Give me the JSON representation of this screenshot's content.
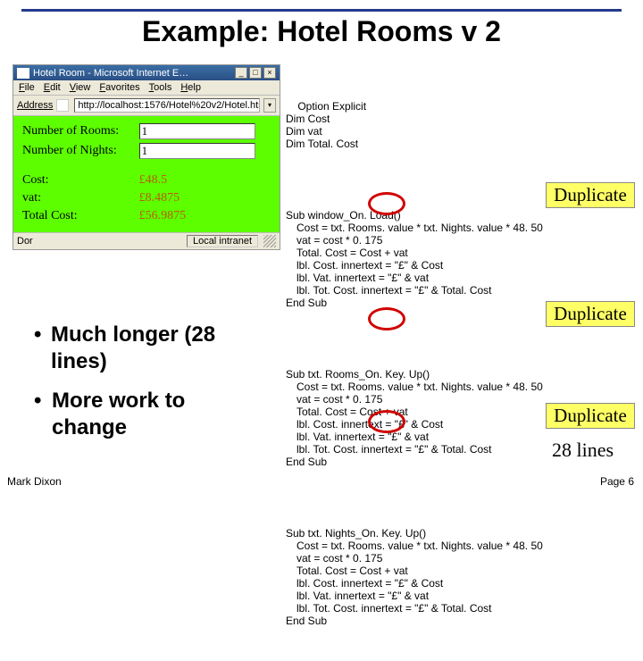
{
  "title": "Example: Hotel Rooms v 2",
  "browser": {
    "window_title": "Hotel Room - Microsoft Internet E…",
    "menu": [
      "File",
      "Edit",
      "View",
      "Favorites",
      "Tools",
      "Help"
    ],
    "address_label": "Address",
    "url": "http://localhost:1576/Hotel%20v2/Hotel.htm",
    "form": {
      "rooms_label": "Number of Rooms:",
      "rooms_value": "1",
      "nights_label": "Number of Nights:",
      "nights_value": "1",
      "cost_label": "Cost:",
      "cost_value": "£48.5",
      "vat_label": "vat:",
      "vat_value": "£8.4875",
      "total_label": "Total Cost:",
      "total_value": "£56.9875"
    },
    "status_left": "Dor",
    "status_zone": "Local intranet"
  },
  "code": {
    "pre": [
      "Option Explicit",
      "Dim Cost",
      "Dim vat",
      "Dim Total. Cost"
    ],
    "subs": [
      {
        "head": "Sub window_On. Load()",
        "body": [
          "Cost = txt. Rooms. value * txt. Nights. value * 48. 50",
          "vat = cost * 0. 175",
          "Total. Cost = Cost + vat",
          "lbl. Cost. innertext = \"£\" & Cost",
          "lbl. Vat. innertext = \"£\" & vat",
          "lbl. Tot. Cost. innertext = \"£\" & Total. Cost"
        ],
        "end": "End Sub"
      },
      {
        "head": "Sub txt. Rooms_On. Key. Up()",
        "body": [
          "Cost = txt. Rooms. value * txt. Nights. value * 48. 50",
          "vat = cost * 0. 175",
          "Total. Cost = Cost + vat",
          "lbl. Cost. innertext = \"£\" & Cost",
          "lbl. Vat. innertext = \"£\" & vat",
          "lbl. Tot. Cost. innertext = \"£\" & Total. Cost"
        ],
        "end": "End Sub"
      },
      {
        "head": "Sub txt. Nights_On. Key. Up()",
        "body": [
          "Cost = txt. Rooms. value * txt. Nights. value * 48. 50",
          "vat = cost * 0. 175",
          "Total. Cost = Cost + vat",
          "lbl. Cost. innertext = \"£\" & Cost",
          "lbl. Vat. innertext = \"£\" & vat",
          "lbl. Tot. Cost. innertext = \"£\" & Total. Cost"
        ],
        "end": "End Sub"
      }
    ]
  },
  "duplicate_label": "Duplicate",
  "lines_count": "28 lines",
  "bullets": [
    "Much longer (28 lines)",
    "More work to change"
  ],
  "footer": {
    "left": "Mark Dixon",
    "right": "Page 6"
  }
}
